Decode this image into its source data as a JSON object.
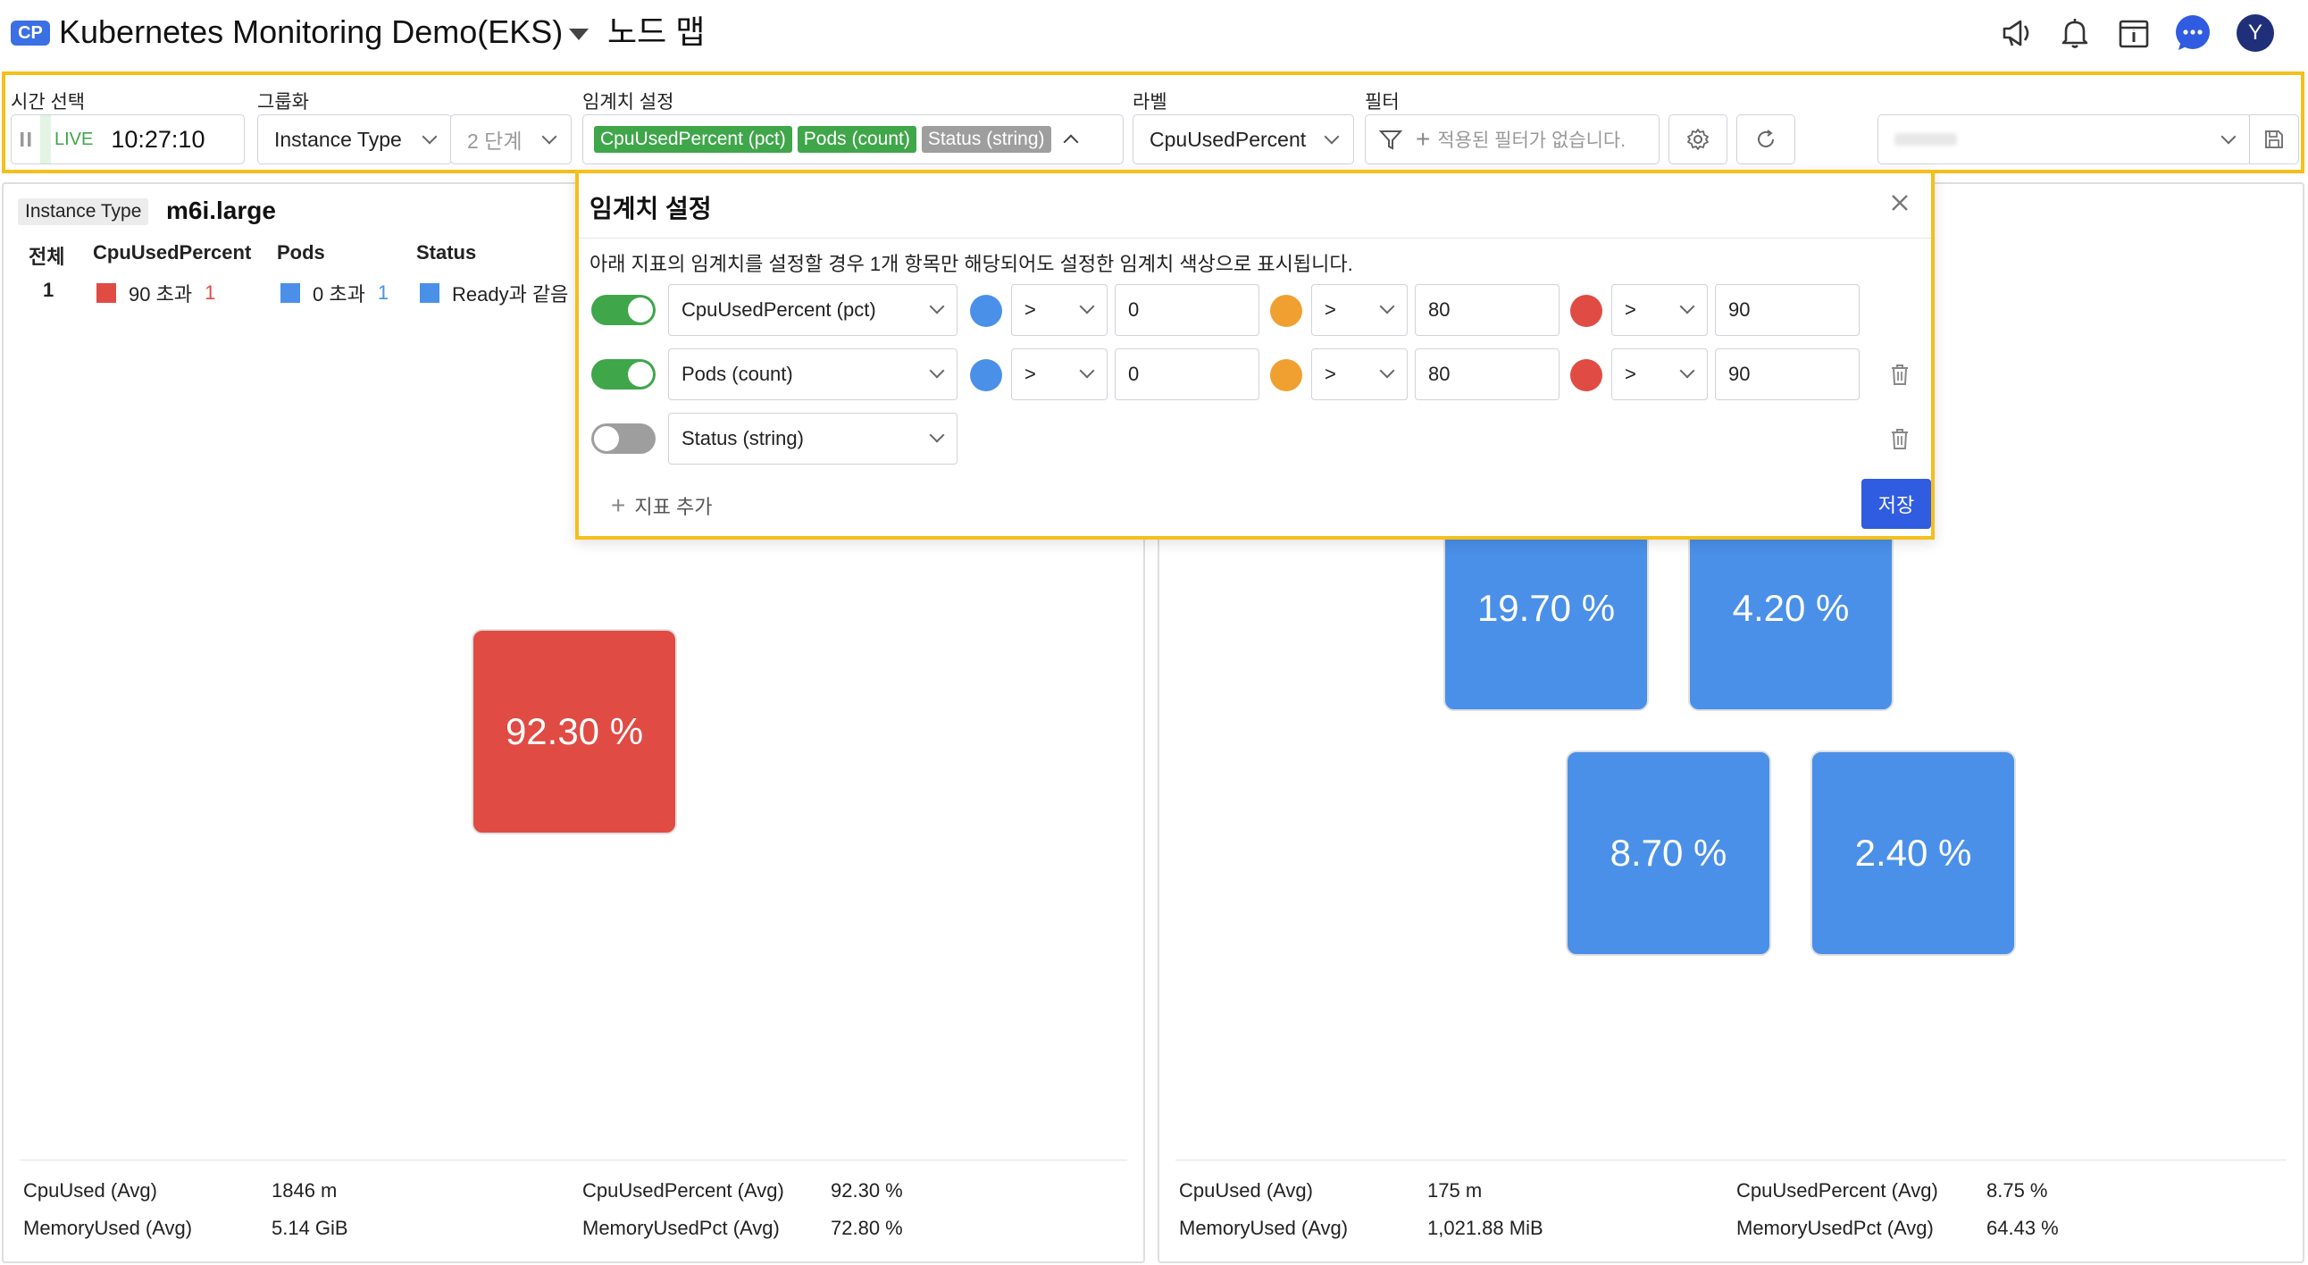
{
  "header": {
    "badge": "CP",
    "project_title": "Kubernetes Monitoring Demo(EKS)",
    "page_title": "노드 맵",
    "avatar_letter": "Y",
    "icons": [
      "megaphone-icon",
      "bell-icon",
      "calendar-icon",
      "chat-icon",
      "avatar"
    ]
  },
  "toolbar": {
    "time": {
      "label": "시간 선택",
      "live": "LIVE",
      "clock": "10:27:10"
    },
    "grouping": {
      "label": "그룹화",
      "value": "Instance Type",
      "depth": "2 단계"
    },
    "threshold": {
      "label": "임계치 설정",
      "tags": [
        {
          "text": "CpuUsedPercent (pct)",
          "color": "#3fa64a"
        },
        {
          "text": "Pods (count)",
          "color": "#3fa64a"
        },
        {
          "text": "Status (string)",
          "color": "#9e9e9e"
        }
      ]
    },
    "label": {
      "label": "라벨",
      "value": "CpuUsedPercent"
    },
    "filter": {
      "label": "필터",
      "placeholder": "적용된 필터가 없습니다."
    }
  },
  "left_panel": {
    "group_key": "Instance Type",
    "group_value": "m6i.large",
    "headers": [
      "전체",
      "CpuUsedPercent",
      "Pods",
      "Status"
    ],
    "total": "1",
    "cpu": {
      "text": "90 초과",
      "count": "1",
      "color": "#e04b43"
    },
    "pods": {
      "text": "0 초과",
      "count": "1",
      "color": "#4a90e8"
    },
    "status": {
      "text": "Ready과 같음",
      "color": "#4a90e8"
    },
    "tiles": [
      {
        "value": "92.30 %",
        "color": "#e04b43"
      }
    ],
    "footer": {
      "cpu_used_label": "CpuUsed (Avg)",
      "cpu_used_value": "1846 m",
      "mem_used_label": "MemoryUsed (Avg)",
      "mem_used_value": "5.14 GiB",
      "cpu_pct_label": "CpuUsedPercent (Avg)",
      "cpu_pct_value": "92.30 %",
      "mem_pct_label": "MemoryUsedPct (Avg)",
      "mem_pct_value": "72.80 %"
    }
  },
  "right_panel": {
    "tiles": [
      {
        "value": "19.70 %",
        "color": "#4a90e8"
      },
      {
        "value": "4.20 %",
        "color": "#4a90e8"
      },
      {
        "value": "8.70 %",
        "color": "#4a90e8"
      },
      {
        "value": "2.40 %",
        "color": "#4a90e8"
      }
    ],
    "footer": {
      "cpu_used_label": "CpuUsed (Avg)",
      "cpu_used_value": "175 m",
      "mem_used_label": "MemoryUsed (Avg)",
      "mem_used_value": "1,021.88 MiB",
      "cpu_pct_label": "CpuUsedPercent (Avg)",
      "cpu_pct_value": "8.75 %",
      "mem_pct_label": "MemoryUsedPct (Avg)",
      "mem_pct_value": "64.43 %"
    }
  },
  "modal": {
    "title": "임계치 설정",
    "description": "아래 지표의 임계치를 설정할 경우 1개 항목만 해당되어도 설정한 임계치 색상으로 표시됩니다.",
    "rows": [
      {
        "enabled": true,
        "metric": "CpuUsedPercent (pct)",
        "levels": [
          {
            "color": "#4a90e8",
            "op": ">",
            "value": "0"
          },
          {
            "color": "#f0a030",
            "op": ">",
            "value": "80"
          },
          {
            "color": "#e04b43",
            "op": ">",
            "value": "90"
          }
        ]
      },
      {
        "enabled": true,
        "metric": "Pods (count)",
        "levels": [
          {
            "color": "#4a90e8",
            "op": ">",
            "value": "0"
          },
          {
            "color": "#f0a030",
            "op": ">",
            "value": "80"
          },
          {
            "color": "#e04b43",
            "op": ">",
            "value": "90"
          }
        ]
      },
      {
        "enabled": false,
        "metric": "Status (string)",
        "levels": []
      }
    ],
    "add_label": "지표 추가",
    "save_label": "저장"
  },
  "colors": {
    "accent": "#2f5ce0",
    "highlight": "#f5bf1c",
    "toggle_on": "#3fa64a",
    "toggle_off": "#9e9e9e"
  }
}
